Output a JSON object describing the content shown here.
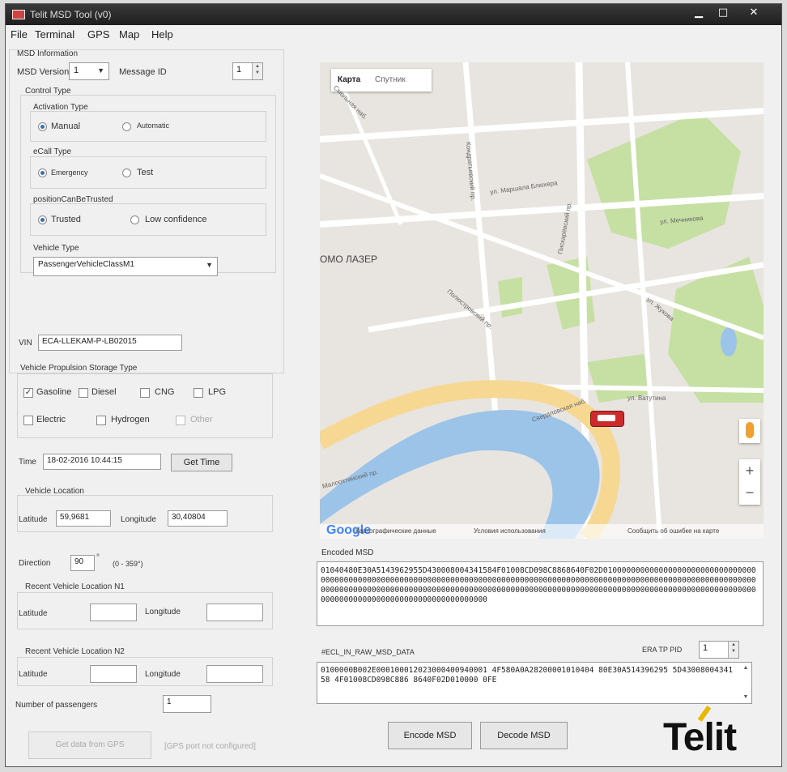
{
  "window": {
    "title": "Telit MSD Tool (v0)"
  },
  "menu": [
    "File",
    "Terminal",
    "GPS",
    "Map",
    "Help"
  ],
  "msd_info": {
    "section_title": "MSD Information",
    "msd_version_label": "MSD Version",
    "msd_version": "1",
    "message_id_label": "Message ID",
    "message_id": "1"
  },
  "control_type": {
    "title": "Control Type",
    "activation_type_label": "Activation Type",
    "activation_options": [
      "Manual",
      "Automatic"
    ],
    "activation_selected": "Manual",
    "ecall_type_label": "eCall Type",
    "ecall_options": [
      "Emergency",
      "Test"
    ],
    "ecall_selected": "Emergency",
    "position_label": "positionCanBeTrusted",
    "position_options": [
      "Trusted",
      "Low confidence"
    ],
    "position_selected": "Trusted"
  },
  "vehicle_type": {
    "label": "Vehicle Type",
    "value": "PassengerVehicleClassM1"
  },
  "vin": {
    "label": "VIN",
    "value": "ECA-LLEKAM-P-LB02015"
  },
  "propulsion": {
    "label": "Vehicle Propulsion Storage Type",
    "row1": [
      {
        "label": "Gasoline",
        "checked": true
      },
      {
        "label": "Diesel",
        "checked": false
      },
      {
        "label": "CNG",
        "checked": false
      },
      {
        "label": "LPG",
        "checked": false
      }
    ],
    "row2": [
      {
        "label": "Electric",
        "checked": false
      },
      {
        "label": "Hydrogen",
        "checked": false
      },
      {
        "label": "Other",
        "checked": false,
        "disabled": true
      }
    ]
  },
  "time": {
    "label": "Time",
    "value": "18-02-2016 10:44:15",
    "button": "Get Time"
  },
  "location": {
    "title": "Vehicle Location",
    "latitude_label": "Latitude",
    "latitude": "59,9681",
    "longitude_label": "Longitude",
    "longitude": "30,40804"
  },
  "direction": {
    "label": "Direction",
    "value": "90",
    "unit": "°",
    "range": "(0 - 359°)"
  },
  "recent1": {
    "title": "Recent Vehicle Location N1",
    "latitude_label": "Latitude",
    "longitude_label": "Longitude",
    "latitude": "",
    "longitude": ""
  },
  "recent2": {
    "title": "Recent Vehicle Location N2",
    "latitude_label": "Latitude",
    "longitude_label": "Longitude",
    "latitude": "",
    "longitude": ""
  },
  "passengers": {
    "label": "Number of passengers",
    "value": "1"
  },
  "gps": {
    "button": "Get data from GPS",
    "status": "[GPS port not configured]"
  },
  "map": {
    "tabs": [
      "Карта",
      "Спутник"
    ],
    "place_label": "ОМО ЛАЗЕР",
    "street_labels": [
      "Смольная наб.",
      "Полюстровский пр.",
      "ул. Маршала Блюхера",
      "Кондратьевский пр.",
      "Пискарёвский пр.",
      "ул. Мечникова",
      "ул. Жукова",
      "Свердловская наб.",
      "Малоохтинский пр.",
      "ул. Ватутина"
    ],
    "google": "Google",
    "footer_links": [
      "Картографические данные",
      "Условия использования",
      "Сообщить об ошибке на карте"
    ],
    "zoom_in": "+",
    "zoom_out": "−"
  },
  "encoded_msd": {
    "label": "Encoded MSD",
    "text": "01040480E30A5143962955D430008004341584F01008CD098C8868640F02D01000000000000000000000000000000000000000000000000000000000000000000000000000000000000000000000000000000000000000000000000000000000000000000000000000000000000000000000000000000000000000000000000000000000000000000000000000000000000000000000000000000000000000"
  },
  "raw_msd": {
    "label": "#ECL_IN_RAW_MSD_DATA",
    "pid_label": "ERA TP PID",
    "pid": "1",
    "text": "0100000B002E000100012023000400940001 4F580A0A28200001010404 80E30A514396295 5D4300800434158 4F01008CD098C886 8640F02D010000 0FE"
  },
  "actions": {
    "encode": "Encode MSD",
    "decode": "Decode MSD"
  },
  "logo": "Telit",
  "colors": {
    "water": "#9cc3e8",
    "park": "#c6dfa2",
    "road": "#ffffff",
    "river_bank": "#f7d893",
    "car": "#cc2b2b"
  }
}
